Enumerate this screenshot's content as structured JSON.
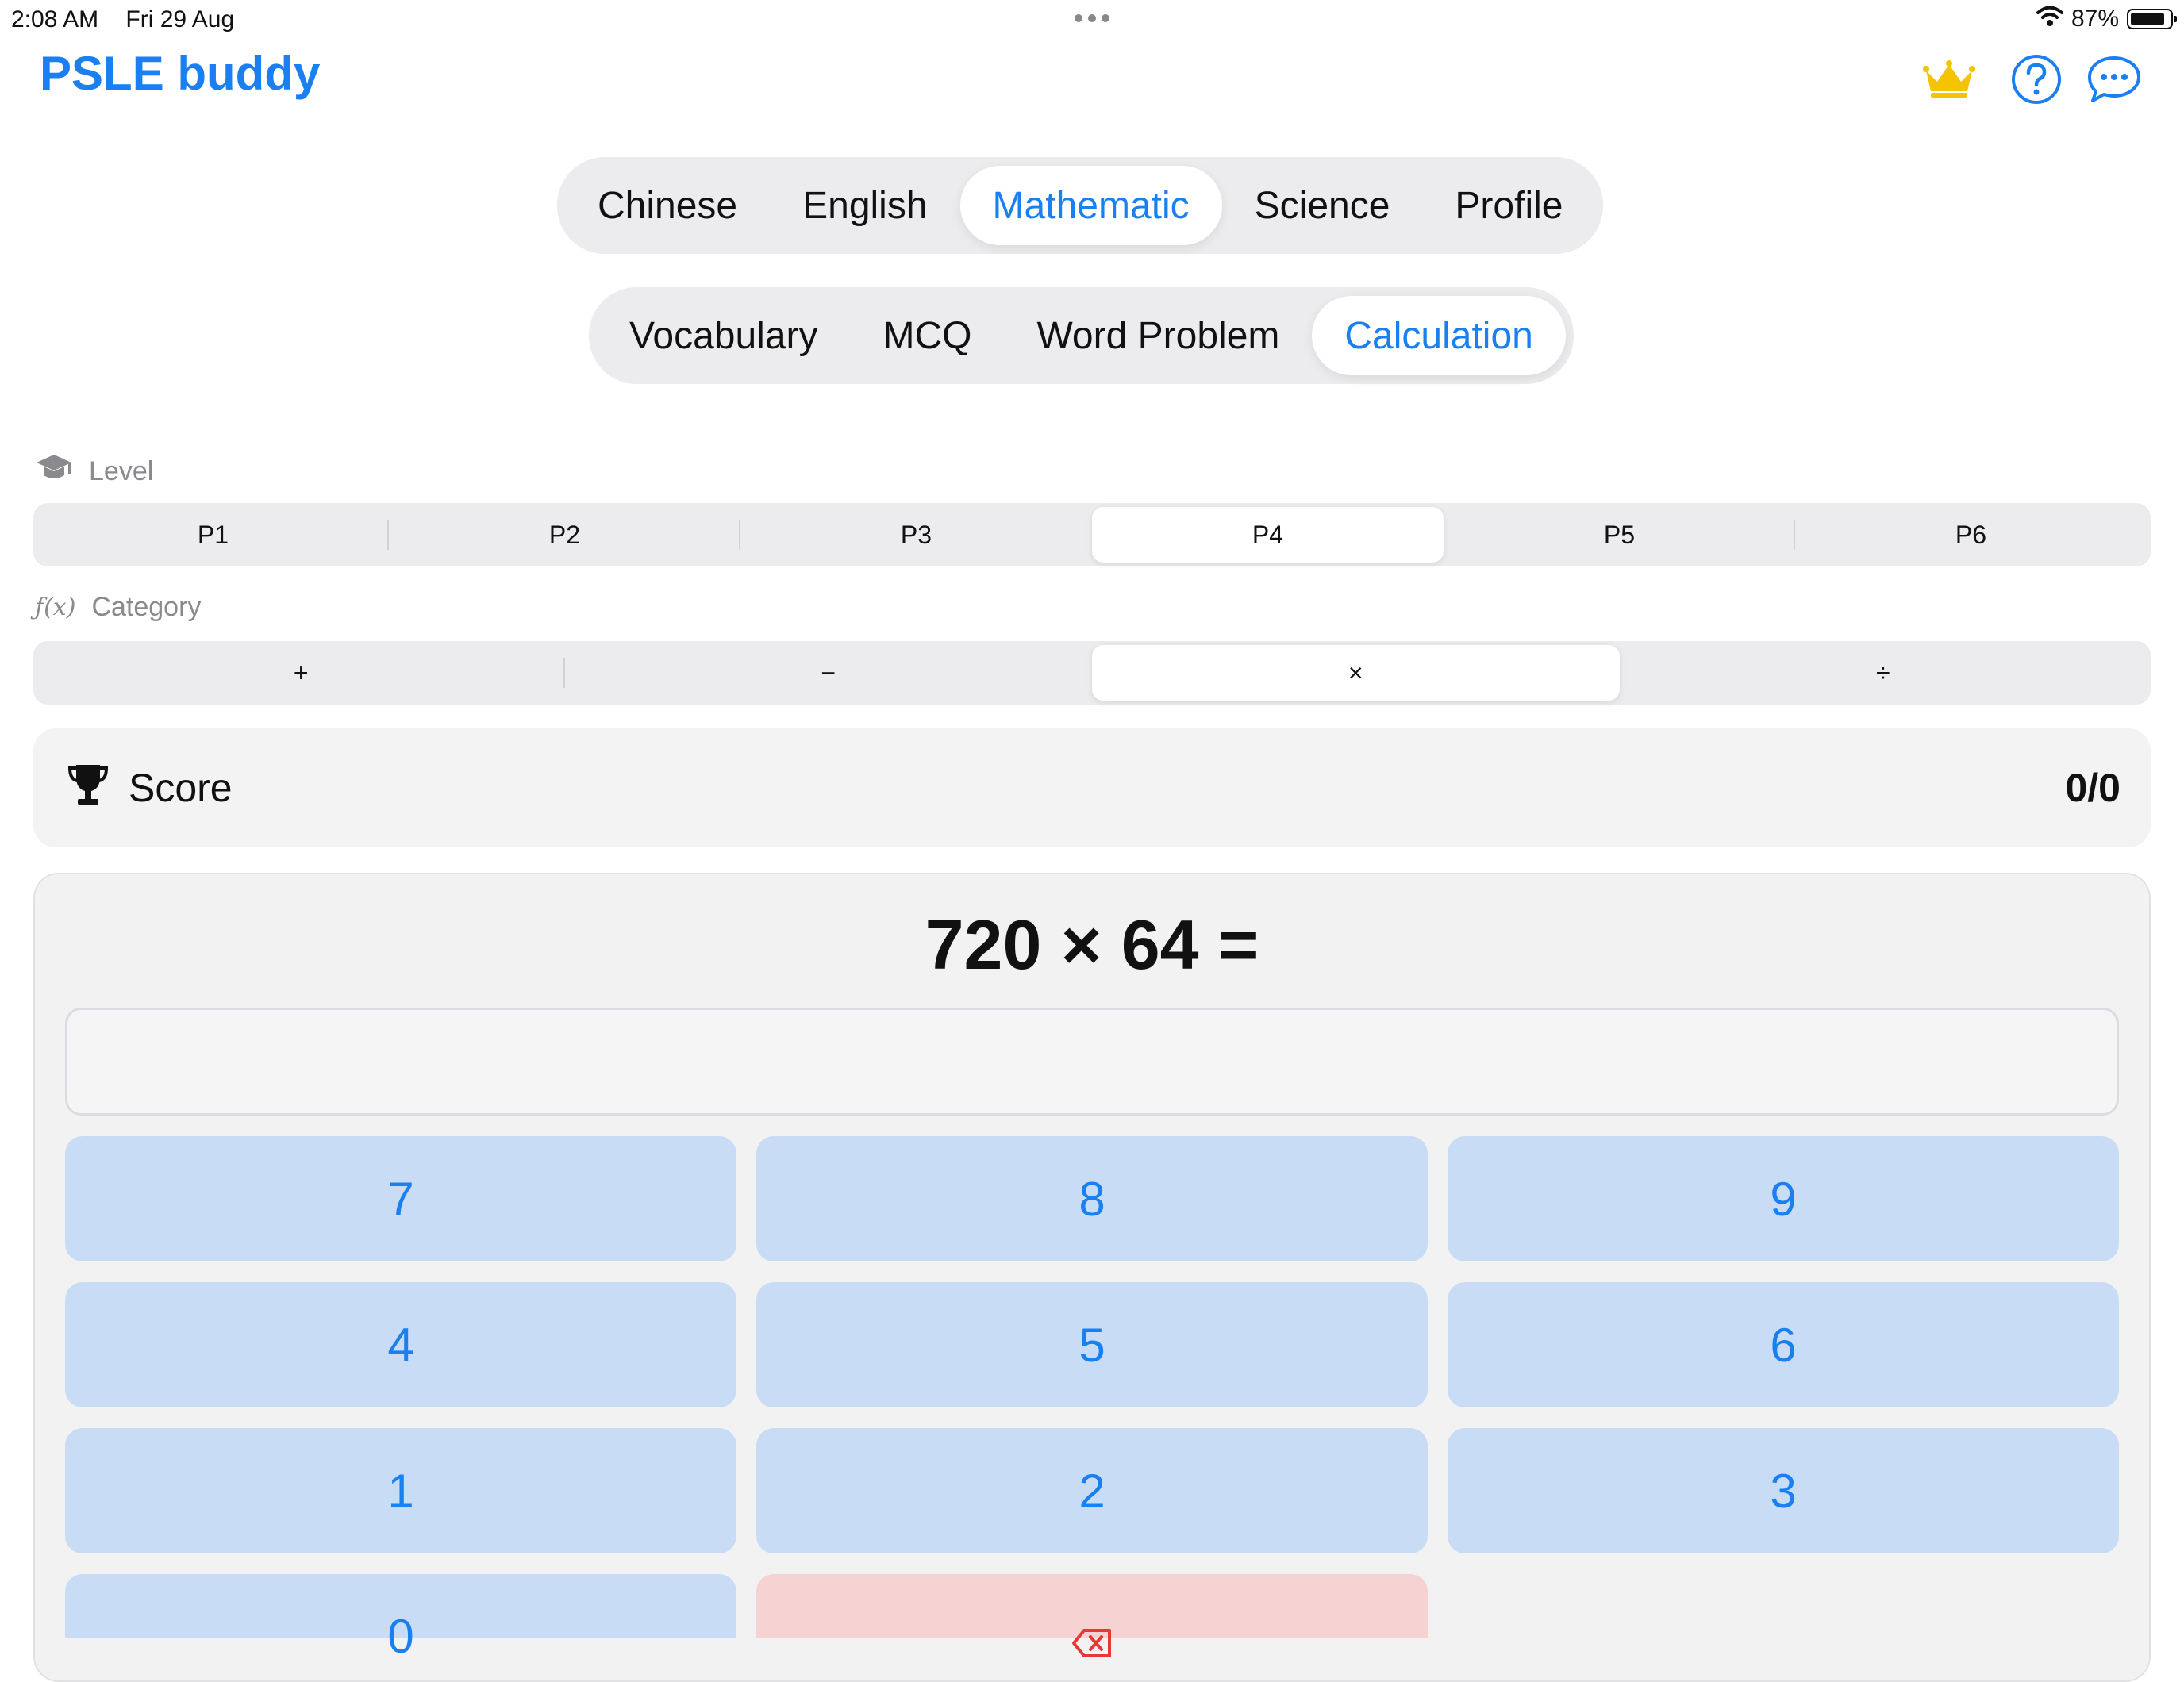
{
  "status_bar": {
    "time": "2:08 AM",
    "date": "Fri 29 Aug",
    "battery": "87%",
    "battery_level": 0.87,
    "icons": [
      "wifi-icon",
      "battery-icon"
    ]
  },
  "header": {
    "title": "PSLE buddy",
    "icons": [
      "crown-icon",
      "help-icon",
      "chat-icon"
    ]
  },
  "subject_tabs": {
    "items": [
      "Chinese",
      "English",
      "Mathematic",
      "Science",
      "Profile"
    ],
    "selected": "Mathematic"
  },
  "mode_tabs": {
    "items": [
      "Vocabulary",
      "MCQ",
      "Word Problem",
      "Calculation"
    ],
    "selected": "Calculation"
  },
  "level": {
    "label": "Level",
    "options": [
      "P1",
      "P2",
      "P3",
      "P4",
      "P5",
      "P6"
    ],
    "selected": "P4"
  },
  "category": {
    "label": "Category",
    "icon_text": "ƒ(x)",
    "options": [
      "+",
      "−",
      "×",
      "÷"
    ],
    "selected": "×"
  },
  "score": {
    "label": "Score",
    "value": "0/0"
  },
  "problem": {
    "text": "720 × 64 =",
    "answer_value": "",
    "answer_placeholder": ""
  },
  "keypad": {
    "keys": [
      "7",
      "8",
      "9",
      "4",
      "5",
      "6",
      "1",
      "2",
      "3",
      "0"
    ],
    "delete_icon": "delete-backspace-icon"
  },
  "colors": {
    "accent": "#1a7ff0",
    "crown": "#f5c400",
    "key_bg": "#c8ddf5",
    "delete_bg": "#f6d2d2",
    "delete_icon": "#e53935"
  }
}
